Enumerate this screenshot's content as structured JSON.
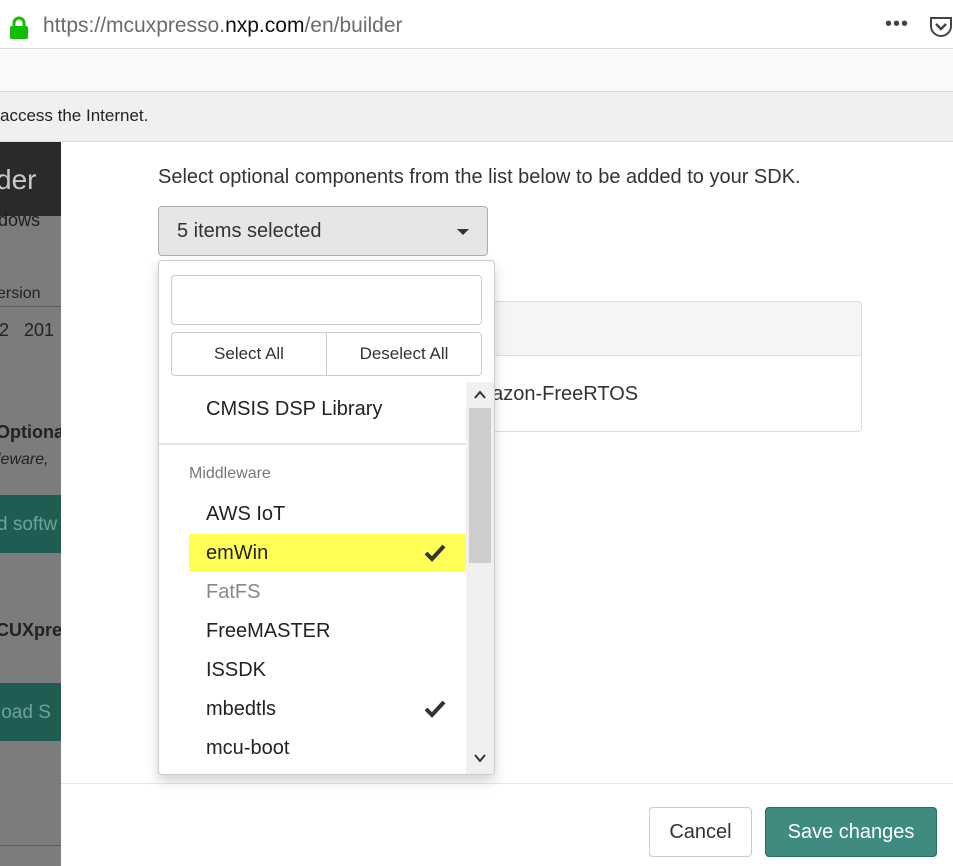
{
  "browser": {
    "url_pre": "https://mcuxpresso.",
    "url_domain": "nxp.com",
    "url_post": "/en/builder",
    "more_icon": "•••",
    "notice": "access the Internet."
  },
  "background": {
    "title_fragment": "der",
    "subtitle_fragment": "dows",
    "version_fragment": "ersion",
    "version_values": "2   201",
    "optional_fragment": "Optiona",
    "optional_sub_fragment": "leware,",
    "button1_fragment": "d softw",
    "heading_fragment": "CUXpre",
    "button2_fragment": "load S"
  },
  "modal": {
    "intro": "Select optional components from the list below to be added to your SDK.",
    "dropdown_label": "5 items selected",
    "panel_text": "B stack,  Amazon-FreeRTOS",
    "cancel_label": "Cancel",
    "save_label": "Save changes"
  },
  "menu": {
    "search_placeholder": "",
    "search_value": "",
    "select_all": "Select All",
    "deselect_all": "Deselect All",
    "top_item": "CMSIS DSP Library",
    "group_header": "Middleware",
    "items": [
      {
        "label": "AWS IoT",
        "checked": false,
        "highlighted": false,
        "disabled": false
      },
      {
        "label": "emWin",
        "checked": true,
        "highlighted": true,
        "disabled": false
      },
      {
        "label": "FatFS",
        "checked": false,
        "highlighted": false,
        "disabled": true
      },
      {
        "label": "FreeMASTER",
        "checked": false,
        "highlighted": false,
        "disabled": false
      },
      {
        "label": "ISSDK",
        "checked": false,
        "highlighted": false,
        "disabled": false
      },
      {
        "label": "mbedtls",
        "checked": true,
        "highlighted": false,
        "disabled": false
      },
      {
        "label": "mcu-boot",
        "checked": false,
        "highlighted": false,
        "disabled": false
      }
    ]
  },
  "colors": {
    "highlight": "#ffff55",
    "primary_button": "#3f8b80",
    "lock_green": "#12bc00",
    "background_green": "#1e5c54"
  }
}
